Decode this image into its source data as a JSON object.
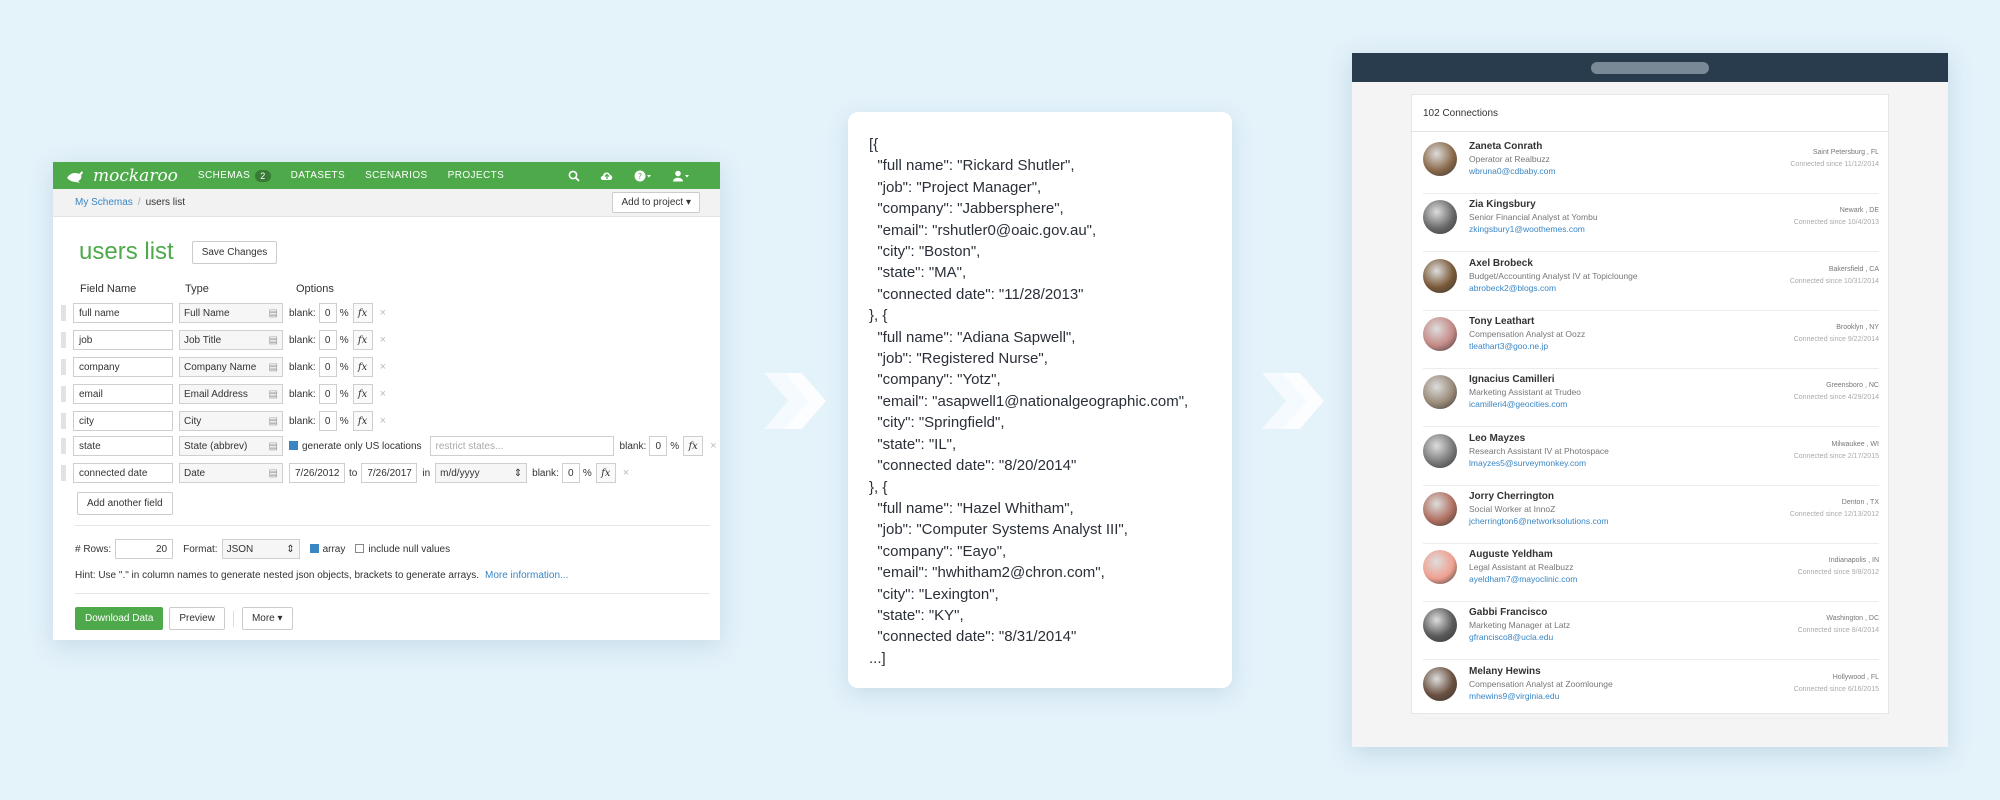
{
  "mockaroo": {
    "logo_text": "mockaroo",
    "nav": [
      {
        "label": "SCHEMAS",
        "badge": "2"
      },
      {
        "label": "DATASETS"
      },
      {
        "label": "SCENARIOS"
      },
      {
        "label": "PROJECTS"
      }
    ],
    "breadcrumb": {
      "parent": "My Schemas",
      "separator": "/",
      "current": "users list"
    },
    "add_to_project": "Add to project ▾",
    "schema_title": "users list",
    "save_changes": "Save Changes",
    "headers": {
      "field_name": "Field Name",
      "type": "Type",
      "options": "Options"
    },
    "fields": [
      {
        "name": "full name",
        "type": "Full Name"
      },
      {
        "name": "job",
        "type": "Job Title"
      },
      {
        "name": "company",
        "type": "Company Name"
      },
      {
        "name": "email",
        "type": "Email Address"
      },
      {
        "name": "city",
        "type": "City"
      }
    ],
    "blank_label": "blank:",
    "blank_value": "0",
    "percent": "%",
    "fx": "fx",
    "remove": "×",
    "state_field": {
      "name": "state",
      "type": "State (abbrev)",
      "option_label": "generate only US locations",
      "placeholder": "restrict states..."
    },
    "date_field": {
      "name": "connected date",
      "type": "Date",
      "from": "7/26/2012",
      "to_label": "to",
      "to": "7/26/2017",
      "in_label": "in",
      "format": "m/d/yyyy"
    },
    "add_another_field": "Add another field",
    "rows_label": "# Rows:",
    "rows_value": "20",
    "format_label": "Format:",
    "format_value": "JSON",
    "array_label": "array",
    "null_label": "include null values",
    "hint": "Hint: Use \".\" in column names to generate nested json objects, brackets to generate arrays.",
    "more_info": "More information...",
    "download": "Download Data",
    "preview": "Preview",
    "more": "More ▾"
  },
  "json_output": "[{\n  \"full name\": \"Rickard Shutler\",\n  \"job\": \"Project Manager\",\n  \"company\": \"Jabbersphere\",\n  \"email\": \"rshutler0@oaic.gov.au\",\n  \"city\": \"Boston\",\n  \"state\": \"MA\",\n  \"connected date\": \"11/28/2013\"\n}, {\n  \"full name\": \"Adiana Sapwell\",\n  \"job\": \"Registered Nurse\",\n  \"company\": \"Yotz\",\n  \"email\": \"asapwell1@nationalgeographic.com\",\n  \"city\": \"Springfield\",\n  \"state\": \"IL\",\n  \"connected date\": \"8/20/2014\"\n}, {\n  \"full name\": \"Hazel Whitham\",\n  \"job\": \"Computer Systems Analyst III\",\n  \"company\": \"Eayo\",\n  \"email\": \"hwhitham2@chron.com\",\n  \"city\": \"Lexington\",\n  \"state\": \"KY\",\n  \"connected date\": \"8/31/2014\"\n...]",
  "connections": {
    "title": "102 Connections",
    "at": "at",
    "since_label": "Connected since",
    "items": [
      {
        "name": "Zaneta Conrath",
        "job": "Operator",
        "company": "Realbuzz",
        "email": "wbruna0@cdbaby.com",
        "location": "Saint Petersburg , FL",
        "since": "11/12/2014",
        "color": "#8a6a4a"
      },
      {
        "name": "Zia Kingsbury",
        "job": "Senior Financial Analyst",
        "company": "Yombu",
        "email": "zkingsbury1@woothemes.com",
        "location": "Newark , DE",
        "since": "10/4/2013",
        "color": "#6a6a6a"
      },
      {
        "name": "Axel Brobeck",
        "job": "Budget/Accounting Analyst IV",
        "company": "Topiclounge",
        "email": "abrobeck2@blogs.com",
        "location": "Bakersfield , CA",
        "since": "10/31/2014",
        "color": "#7a5a38"
      },
      {
        "name": "Tony Leathart",
        "job": "Compensation Analyst",
        "company": "Oozz",
        "email": "tleathart3@goo.ne.jp",
        "location": "Brooklyn , NY",
        "since": "9/22/2014",
        "color": "#c48a86"
      },
      {
        "name": "Ignacius Camilleri",
        "job": "Marketing Assistant",
        "company": "Trudeo",
        "email": "icamilleri4@geocities.com",
        "location": "Greensboro , NC",
        "since": "4/29/2014",
        "color": "#9a8a78"
      },
      {
        "name": "Leo Mayzes",
        "job": "Research Assistant IV",
        "company": "Photospace",
        "email": "lmayzes5@surveymonkey.com",
        "location": "Milwaukee , WI",
        "since": "2/17/2015",
        "color": "#7a7a7a"
      },
      {
        "name": "Jorry Cherrington",
        "job": "Social Worker",
        "company": "InnoZ",
        "email": "jcherrington6@networksolutions.com",
        "location": "Denton , TX",
        "since": "12/13/2012",
        "color": "#b07060"
      },
      {
        "name": "Auguste Yeldham",
        "job": "Legal Assistant",
        "company": "Realbuzz",
        "email": "ayeldham7@mayoclinic.com",
        "location": "Indianapolis , IN",
        "since": "9/8/2012",
        "color": "#f0a090"
      },
      {
        "name": "Gabbi Francisco",
        "job": "Marketing Manager",
        "company": "Latz",
        "email": "gfrancisco8@ucla.edu",
        "location": "Washington , DC",
        "since": "8/4/2014",
        "color": "#5a5a5a"
      },
      {
        "name": "Melany Hewins",
        "job": "Compensation Analyst",
        "company": "Zoomlounge",
        "email": "mhewins9@virginia.edu",
        "location": "Hollywood , FL",
        "since": "6/16/2015",
        "color": "#6a5040"
      }
    ]
  }
}
